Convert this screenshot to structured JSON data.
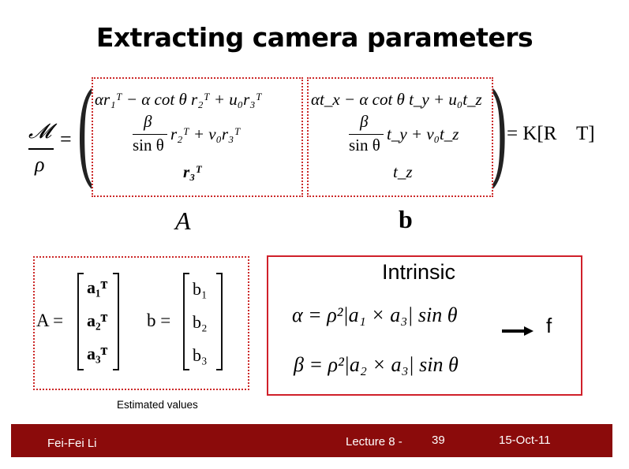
{
  "slide": {
    "title": "Extracting camera parameters"
  },
  "projection": {
    "lhs_numerator": "𝓜",
    "lhs_denominator": "ρ",
    "equals": "=",
    "col_a_row1": "αr₁ᵀ − α cot θ r₂ᵀ + u₀r₃ᵀ",
    "col_a_row2_num": "β",
    "col_a_row2_den": "sin θ",
    "col_a_row2_rest": "r₂ᵀ + v₀r₃ᵀ",
    "col_a_row3": "r₃ᵀ",
    "col_b_row1": "αt_x − α cot θ t_y + u₀t_z",
    "col_b_row2_num": "β",
    "col_b_row2_den": "sin θ",
    "col_b_row2_rest": "t_y + v₀t_z",
    "col_b_row3": "t_z",
    "rhs": "= K[R    T]",
    "label_A": "A",
    "label_b": "b"
  },
  "matrices": {
    "A_label": "A =",
    "A_rows": [
      "a₁ᵀ",
      "a₂ᵀ",
      "a₃ᵀ"
    ],
    "b_label": "b =",
    "b_rows": [
      "b₁",
      "b₂",
      "b₃"
    ],
    "caption": "Estimated values"
  },
  "intrinsic": {
    "heading": "Intrinsic",
    "alpha_eq": "α = ρ²|a₁ × a₃| sin θ",
    "beta_eq": "β = ρ²|a₂ × a₃| sin θ",
    "arrow": "→",
    "result": "f"
  },
  "footer": {
    "author": "Fei-Fei Li",
    "lecture": "Lecture 8 -",
    "page": "39",
    "date": "15-Oct-11",
    "bg_color": "#8b0b0b"
  },
  "colors": {
    "accent": "#cc2a2a"
  }
}
